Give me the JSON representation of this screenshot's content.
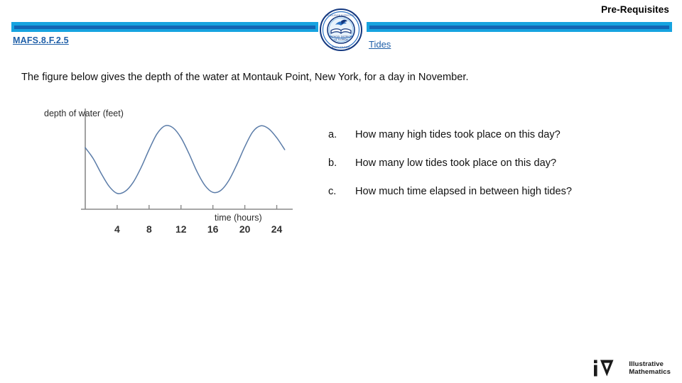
{
  "header": {
    "title": "Pre-Requisites",
    "standard_code": "MAFS.8.F.2.5",
    "lesson_title": "Tides",
    "rule_outer_color": "#16A3E0",
    "rule_inner_color": "#1266B5",
    "link_color": "#1F5FA8",
    "seal_icon": "school-seal-icon"
  },
  "body": {
    "prompt": "The figure below gives the depth of the water at Montauk Point, New York, for a day in November."
  },
  "questions": [
    {
      "letter": "a.",
      "text": "How many high tides took place on this day?"
    },
    {
      "letter": "b.",
      "text": "How many low tides took place on this day?"
    },
    {
      "letter": "c.",
      "text": "How much time elapsed in between high tides?"
    }
  ],
  "chart_data": {
    "type": "line",
    "title": "",
    "xlabel": "time (hours)",
    "ylabel": "depth of water (feet)",
    "xlim": [
      0,
      26
    ],
    "ylim": [
      0,
      10
    ],
    "grid": false,
    "legend": "none",
    "line_color": "#5B7CA8",
    "axis_color": "#8a8a8a",
    "tick_labels": [
      "4",
      "8",
      "12",
      "16",
      "20",
      "24"
    ],
    "tick_values": [
      4,
      8,
      12,
      16,
      20,
      24
    ],
    "annotations": [
      "high tide near t = 10",
      "high tide near t = 22",
      "low tide near t = 4",
      "low tide near t = 16"
    ],
    "x": [
      0,
      1,
      2,
      3,
      4,
      5,
      6,
      7,
      8,
      9,
      10,
      11,
      12,
      13,
      14,
      15,
      16,
      17,
      18,
      19,
      20,
      21,
      22,
      23,
      24,
      25
    ],
    "y": [
      6.2,
      5.1,
      3.6,
      2.3,
      1.6,
      1.8,
      2.7,
      4.2,
      6.0,
      7.6,
      8.4,
      8.2,
      7.2,
      5.6,
      3.8,
      2.4,
      1.7,
      1.9,
      2.9,
      4.5,
      6.3,
      7.8,
      8.4,
      8.1,
      7.2,
      6.0
    ]
  },
  "footer": {
    "brand_line1": "Illustrative",
    "brand_line2": "Mathematics",
    "brand_mark": "im-logo-icon"
  }
}
